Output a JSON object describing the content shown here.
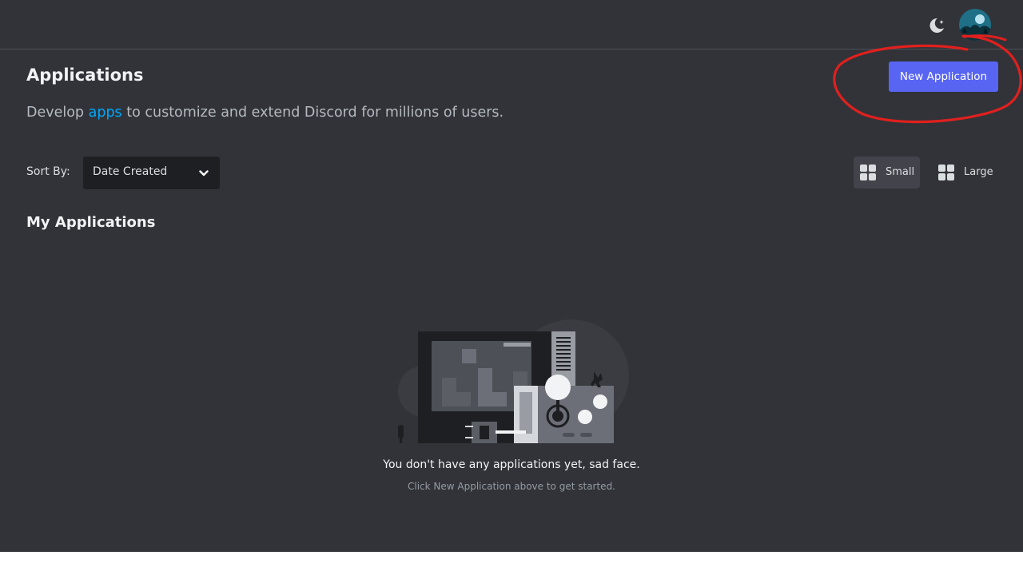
{
  "header": {
    "theme_toggle_icon": "moon-icon",
    "avatar_icon": "user-avatar"
  },
  "page": {
    "title": "Applications",
    "new_app_label": "New Application",
    "subtitle_prefix": "Develop ",
    "subtitle_link": "apps",
    "subtitle_suffix": " to customize and extend Discord for millions of users."
  },
  "controls": {
    "sort_label": "Sort By:",
    "sort_value": "Date Created",
    "view_small": "Small",
    "view_large": "Large",
    "selected_view": "Small"
  },
  "apps": {
    "section_title": "My Applications",
    "empty_title": "You don't have any applications yet, sad face.",
    "empty_subtitle": "Click New Application above to get started."
  },
  "colors": {
    "background": "#313338",
    "primary_button": "#5865f2",
    "link": "#00a8fc",
    "annotation": "#e0201e"
  }
}
